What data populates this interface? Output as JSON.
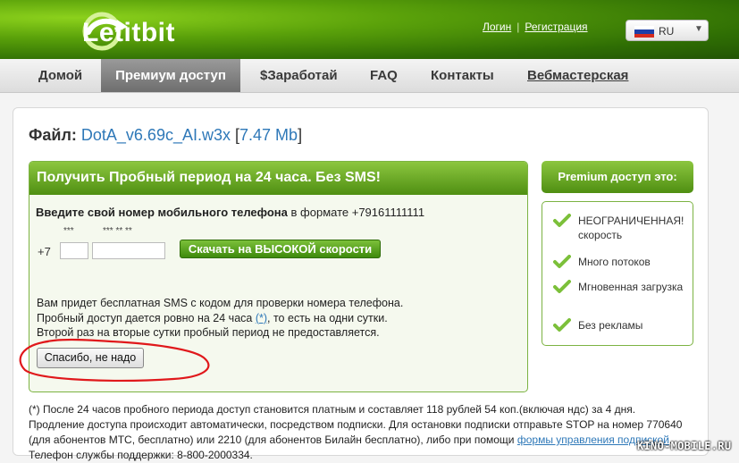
{
  "header": {
    "logo_text": "Letitbit",
    "login_link": "Логин",
    "separator": "|",
    "register_link": "Регистрация",
    "language": "RU"
  },
  "nav": {
    "items": [
      "Домой",
      "Премиум доступ",
      "$Заработай",
      "FAQ",
      "Контакты",
      "Вебмастерская"
    ],
    "active": "Премиум доступ"
  },
  "file": {
    "label": "Файл:",
    "name": "DotA_v6.69c_AI.w3x",
    "size_open": "[",
    "size": "7.47 Mb",
    "size_close": "]"
  },
  "trial": {
    "title": "Получить Пробный период на 24 часа. Без SMS!",
    "instruction_bold": "Введите свой номер мобильного телефона",
    "instruction_rest": " в формате +79161111111",
    "prefix": "+7",
    "mask_code": "***",
    "mask_number": "*** ** **",
    "download_button": "Скачать на ВЫСОКОЙ скорости",
    "info_line1": "Вам придет бесплатная SMS с кодом для проверки номера телефона.",
    "info_line2_a": "Пробный доступ дается ровно на 24 часа ",
    "info_line2_link": "(*)",
    "info_line2_b": ", то есть на одни сутки.",
    "info_line3": "Второй раз на вторые сутки пробный период не предоставляется.",
    "decline_button": "Спасибо, не надо"
  },
  "premium": {
    "title": "Premium доступ это:",
    "features": [
      "НЕОГРАНИЧЕННАЯ! скорость",
      "Много потоков",
      "Мгновенная загрузка",
      "Без рекламы"
    ]
  },
  "footer": {
    "line1": "(*) После 24 часов пробного периода доступ становится платным и составляет 118 рублей 54 коп.(включая ндс) за 4 дня.",
    "line2": "Продление доступа происходит автоматически, посредством подписки. Для остановки подписки отправьте STOP на номер 770640",
    "line3_a": "(для абонентов МТС, бесплатно) или 2210 (для абонентов Билайн бесплатно), либо при помощи ",
    "line3_link": "формы управления подпиской",
    "line3_b": ".",
    "line4": "Телефон службы поддержки: 8-800-2000334."
  },
  "watermark": "KINO-MOBILE.RU",
  "colors": {
    "brand_green": "#4f8f12",
    "link_blue": "#2e78b8",
    "annotation_red": "#e0181b"
  }
}
